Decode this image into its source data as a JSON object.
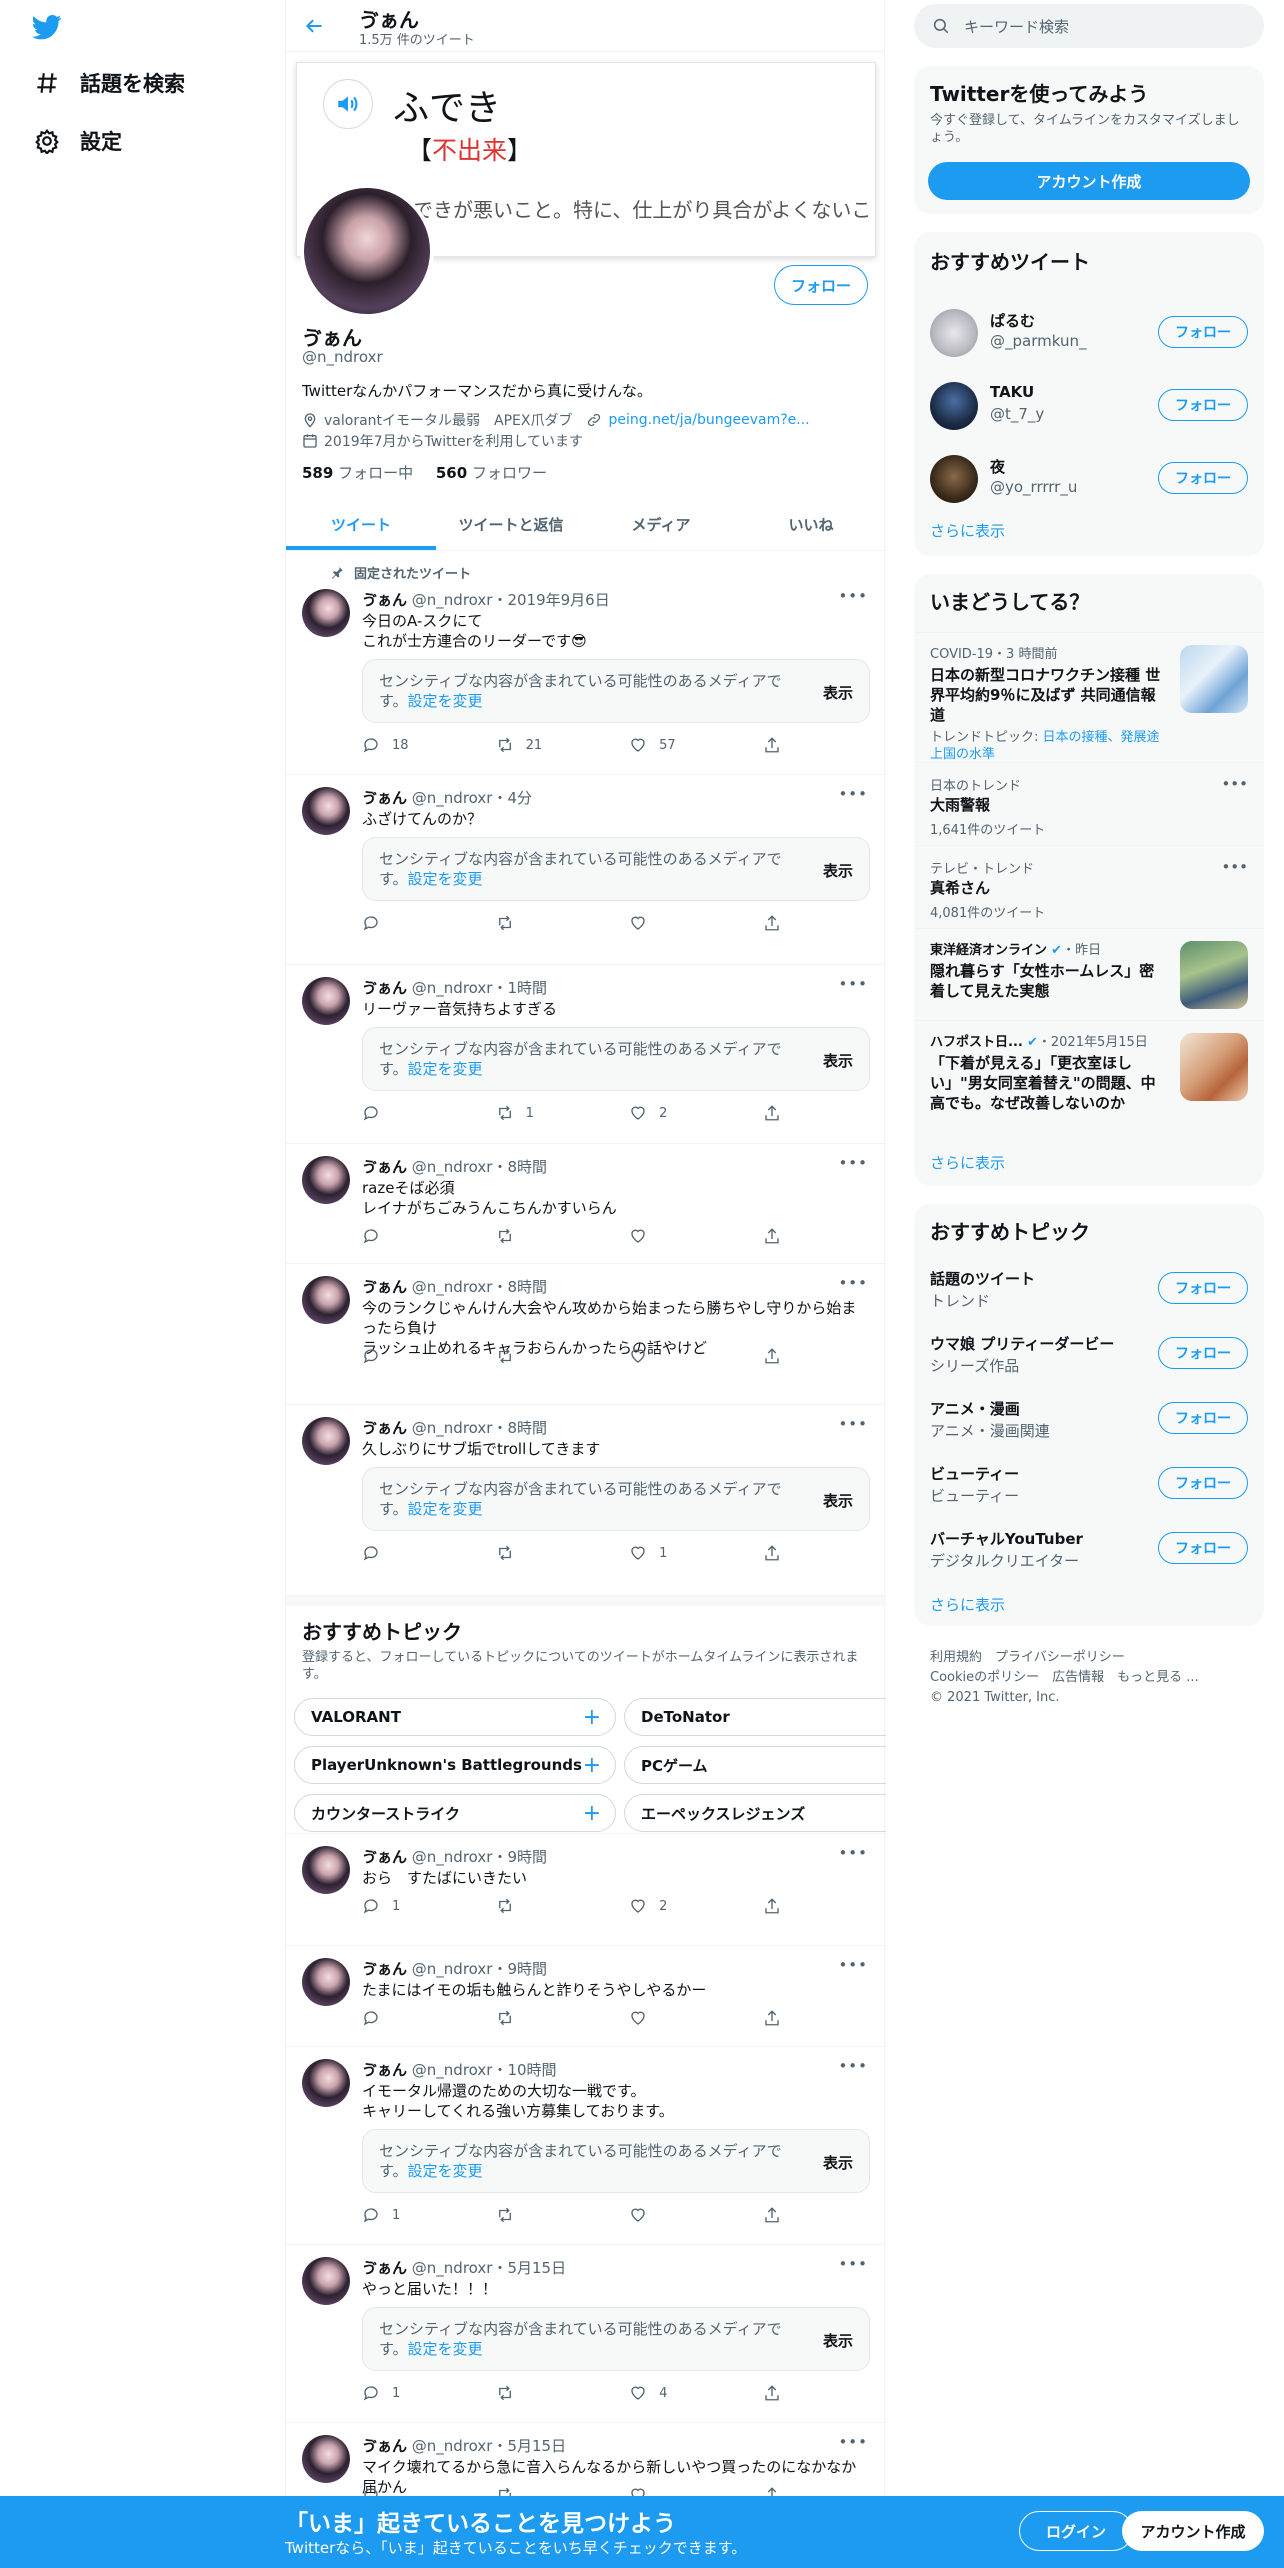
{
  "nav": {
    "explore": "話題を検索",
    "settings": "設定"
  },
  "header": {
    "name": "ゔぁん",
    "tweet_count": "1.5万 件のツイート"
  },
  "banner": {
    "word": "ふでき",
    "kanji_open": "【",
    "kanji": "不出来",
    "kanji_close": "】",
    "definition": "…》できが悪いこと。特に、仕上がり具合がよくないこと。"
  },
  "profile": {
    "name": "ゔぁん",
    "handle": "@n_ndroxr",
    "follow_button": "フォロー",
    "bio": "Twitterなんかパフォーマンスだから真に受けんな。",
    "location": "valorantイモータル最弱　APEX爪ダブ",
    "link": "peing.net/ja/bungeevam?e...",
    "joined": "2019年7月からTwitterを利用しています",
    "following_count": "589",
    "following_label": " フォロー中",
    "followers_count": "560",
    "followers_label": " フォロワー"
  },
  "tabs": [
    "ツイート",
    "ツイートと返信",
    "メディア",
    "いいね"
  ],
  "sensitive": {
    "text": "センシティブな内容が含まれている可能性のあるメディアです。",
    "settings_link": "設定を変更",
    "show": "表示"
  },
  "pinned_label": "固定されたツイート",
  "tweets": [
    {
      "name": "ゔぁん",
      "handle": "@n_ndroxr",
      "time": "2019年9月6日",
      "text": "今日のA-スクにて\nこれが士方連合のリーダーです😎",
      "reply": "18",
      "retweet": "21",
      "like": "57"
    },
    {
      "name": "ゔぁん",
      "handle": "@n_ndroxr",
      "time": "4分",
      "text": "ふざけてんのか？",
      "reply": "",
      "retweet": "",
      "like": ""
    },
    {
      "name": "ゔぁん",
      "handle": "@n_ndroxr",
      "time": "1時間",
      "text": "リーヴァー音気持ちよすぎる",
      "reply": "",
      "retweet": "1",
      "like": "2"
    },
    {
      "name": "ゔぁん",
      "handle": "@n_ndroxr",
      "time": "8時間",
      "text": "razeそば必須\nレイナがちごみうんこちんかすいらん",
      "reply": "",
      "retweet": "",
      "like": ""
    },
    {
      "name": "ゔぁん",
      "handle": "@n_ndroxr",
      "time": "8時間",
      "text": "今のランクじゃんけん大会やん攻めから始まったら勝ちやし守りから始まったら負け\nラッシュ止めれるキャラおらんかったらの話やけど",
      "reply": "",
      "retweet": "",
      "like": ""
    },
    {
      "name": "ゔぁん",
      "handle": "@n_ndroxr",
      "time": "8時間",
      "text": "久しぶりにサブ垢でtrollしてきます",
      "reply": "",
      "retweet": "",
      "like": "1"
    },
    {
      "name": "ゔぁん",
      "handle": "@n_ndroxr",
      "time": "9時間",
      "text": "おら　すたばにいきたい",
      "reply": "1",
      "retweet": "",
      "like": "2"
    },
    {
      "name": "ゔぁん",
      "handle": "@n_ndroxr",
      "time": "9時間",
      "text": "たまにはイモの垢も触らんと詐りそうやしやるかー",
      "reply": "",
      "retweet": "",
      "like": ""
    },
    {
      "name": "ゔぁん",
      "handle": "@n_ndroxr",
      "time": "10時間",
      "text": "イモータル帰還のための大切な一戦です。\nキャリーしてくれる強い方募集しております。",
      "reply": "1",
      "retweet": "",
      "like": ""
    },
    {
      "name": "ゔぁん",
      "handle": "@n_ndroxr",
      "time": "5月15日",
      "text": "やっと届いた！！！",
      "reply": "1",
      "retweet": "",
      "like": "4"
    },
    {
      "name": "ゔぁん",
      "handle": "@n_ndroxr",
      "time": "5月15日",
      "text": "マイク壊れてるから急に音入らんなるから新しいやつ買ったのになかなか届かん",
      "reply": "",
      "retweet": "",
      "like": ""
    }
  ],
  "topics_inline": {
    "title": "おすすめトピック",
    "subtitle": "登録すると、フォローしているトピックについてのツイートがホームタイムラインに表示されます。",
    "chips": [
      "VALORANT",
      "DeToNator",
      "PlayerUnknown's Battlegrounds",
      "PCゲーム",
      "カウンターストライク",
      "エーペックスレジェンズ"
    ]
  },
  "right": {
    "search_placeholder": "キーワード検索",
    "signup_card": {
      "title": "Twitterを使ってみよう",
      "text": "今すぐ登録して、タイムラインをカスタマイズしましょう。",
      "button": "アカウント作成"
    },
    "recommended": {
      "title": "おすすめツイート",
      "follow": "フォロー",
      "more": "さらに表示",
      "users": [
        {
          "name": "ぱるむ",
          "handle": "@_parmkun_"
        },
        {
          "name": "TAKU",
          "handle": "@t_7_y"
        },
        {
          "name": "夜",
          "handle": "@yo_rrrrr_u"
        }
      ]
    },
    "trends": {
      "title": "いまどうしてる？",
      "more": "さらに表示",
      "items": [
        {
          "meta": "COVID-19・3 時間前",
          "title": "日本の新型コロナワクチン接種 世界平均約9％に及ばず 共同通信報道",
          "sub_label": "トレンドトピック: ",
          "sub_link": "日本の接種、発展途上国の水準"
        },
        {
          "meta": "日本のトレンド",
          "title": "大雨警報",
          "sub": "1,641件のツイート"
        },
        {
          "meta": "テレビ・トレンド",
          "title": "真希さん",
          "sub": "4,081件のツイート"
        },
        {
          "meta": "東洋経済オンライン",
          "meta_time": "・昨日",
          "title": "隠れ暮らす「女性ホームレス」密着して見えた実態"
        },
        {
          "meta": "ハフポスト日...",
          "meta_time": "・2021年5月15日",
          "title": "「下着が見える」「更衣室ほしい」\"男女同室着替え\"の問題、中高でも。なぜ改善しないのか"
        }
      ]
    },
    "topics": {
      "title": "おすすめトピック",
      "follow": "フォロー",
      "more": "さらに表示",
      "items": [
        {
          "name": "話題のツイート",
          "sub": "トレンド"
        },
        {
          "name": "ウマ娘 プリティーダービー",
          "sub": "シリーズ作品"
        },
        {
          "name": "アニメ・漫画",
          "sub": "アニメ・漫画関連"
        },
        {
          "name": "ビューティー",
          "sub": "ビューティー"
        },
        {
          "name": "バーチャルYouTuber",
          "sub": "デジタルクリエイター"
        }
      ]
    },
    "footer": {
      "terms": "利用規約",
      "privacy": "プライバシーポリシー",
      "cookie": "Cookieのポリシー",
      "ads": "広告情報",
      "more": "もっと見る ...",
      "copyright": "© 2021 Twitter, Inc."
    }
  },
  "bottom": {
    "title": "「いま」起きていることを見つけよう",
    "subtitle": "Twitterなら、「いま」起きていることをいち早くチェックできます。",
    "login": "ログイン",
    "signup": "アカウント作成"
  },
  "colors": {
    "accent": "#1d9bf0",
    "text": "#0f1419",
    "muted": "#536471"
  }
}
